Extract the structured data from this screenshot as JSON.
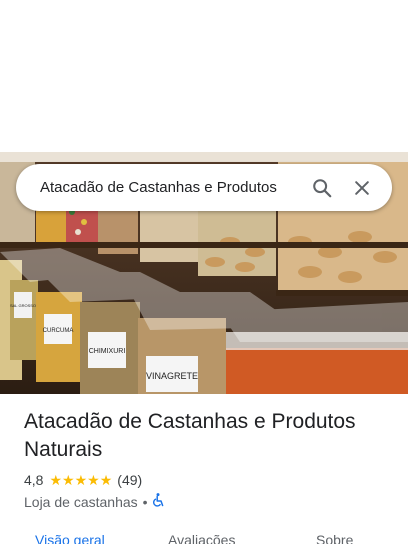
{
  "search": {
    "query": "Atacadão de Castanhas e Produtos",
    "search_icon": "search-icon",
    "close_icon": "close-icon"
  },
  "photo": {
    "description_icon": "place-photo",
    "labels": {
      "curcuma": "CURCUMA",
      "chimixuri": "CHIMIXURI",
      "vinagrete": "VINAGRETE",
      "sal_grosso": "SAL GROSSO"
    }
  },
  "place": {
    "name": "Atacadão de Castanhas e Produtos Naturais",
    "rating": "4,8",
    "stars": 5,
    "reviews_count": "(49)",
    "category": "Loja de castanhas",
    "separator": "•",
    "accessibility_icon": "wheelchair-icon"
  },
  "tabs": [
    {
      "label": "Visão geral",
      "active": true
    },
    {
      "label": "Avaliações",
      "active": false
    },
    {
      "label": "Sobre",
      "active": false
    }
  ],
  "colors": {
    "accent": "#1a73e8",
    "star": "#fbbc04",
    "text": "#202124",
    "secondary": "#5f6368"
  }
}
